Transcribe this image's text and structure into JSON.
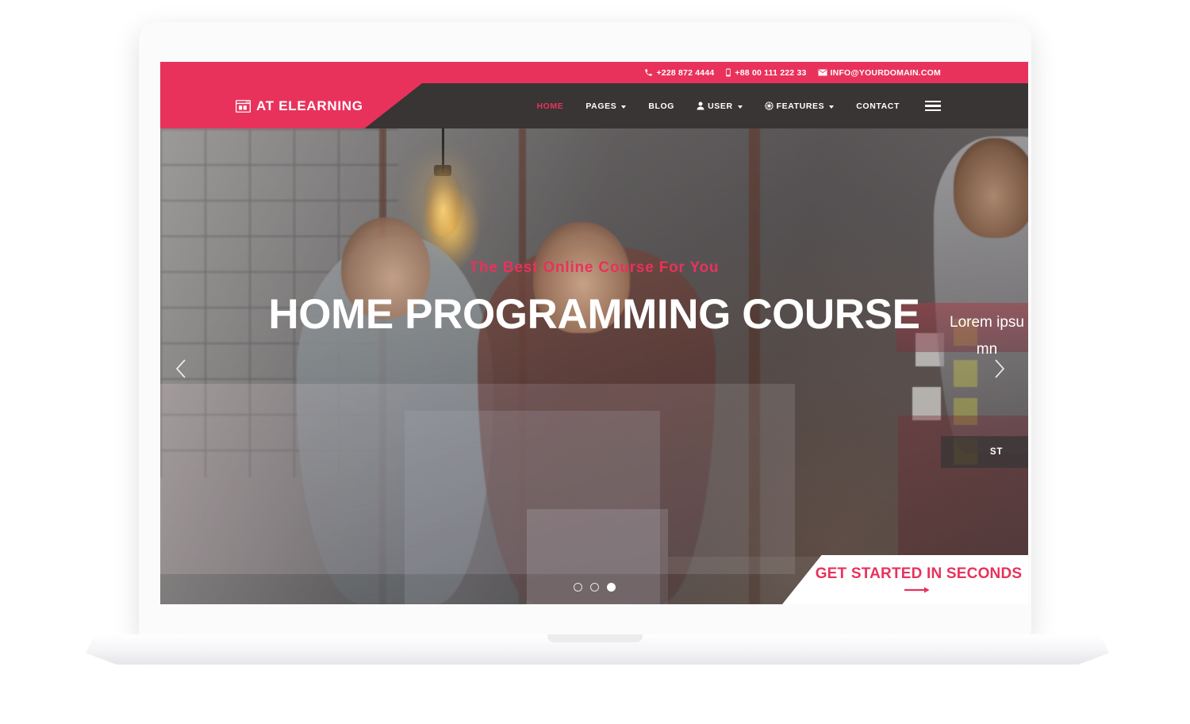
{
  "topbar": {
    "phone1": "+228 872 4444",
    "phone2": "+88 00 111 222 33",
    "email": "INFO@YOURDOMAIN.COM",
    "bg_color": "#e8325c",
    "icons": {
      "phone": "phone-icon",
      "mobile": "mobile-icon",
      "mail": "envelope-icon"
    }
  },
  "header": {
    "logo_text": "AT ELEARNING",
    "logo_icon": "browser-window-icon",
    "nav_bg_color": "#383534",
    "accent_color": "#e8325c",
    "nav": [
      {
        "label": "HOME",
        "active": true,
        "caret": false,
        "icon": ""
      },
      {
        "label": "PAGES",
        "active": false,
        "caret": true,
        "icon": ""
      },
      {
        "label": "BLOG",
        "active": false,
        "caret": false,
        "icon": ""
      },
      {
        "label": "USER",
        "active": false,
        "caret": true,
        "icon": "user-icon"
      },
      {
        "label": "FEATURES",
        "active": false,
        "caret": true,
        "icon": "gear-icon"
      },
      {
        "label": "CONTACT",
        "active": false,
        "caret": false,
        "icon": ""
      }
    ],
    "menu_toggle": "hamburger-icon"
  },
  "hero": {
    "subtitle": "The Best Online Course For You",
    "title": "HOME PROGRAMMING COURSE",
    "prev_icon": "chevron-left-icon",
    "next_icon": "chevron-right-icon",
    "dots": [
      {
        "active": false
      },
      {
        "active": false
      },
      {
        "active": true
      }
    ]
  },
  "next_slide": {
    "line1": "Lorem ipsu",
    "line2": "mn",
    "button_label": "ST"
  },
  "cta": {
    "label": "GET STARTED IN SECONDS",
    "arrow_icon": "arrow-right-icon",
    "color": "#e8325c"
  }
}
